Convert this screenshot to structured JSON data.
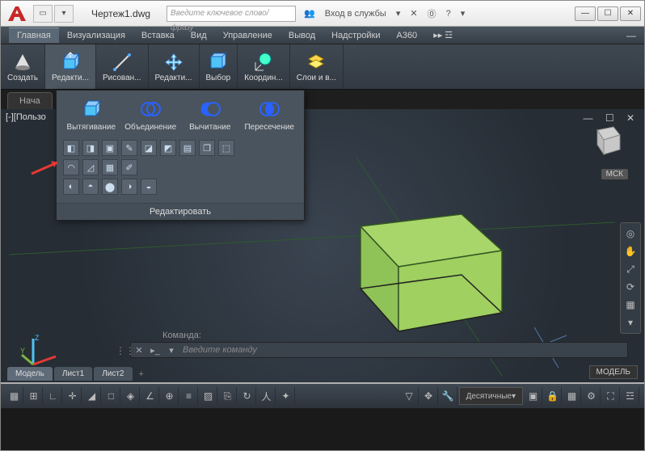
{
  "titlebar": {
    "filename": "Чертеж1.dwg",
    "search_placeholder": "Введите ключевое слово/фразу",
    "signin": "Вход в службы"
  },
  "menubar": {
    "tabs": [
      "Главная",
      "Визуализация",
      "Вставка",
      "Вид",
      "Управление",
      "Вывод",
      "Надстройки",
      "A360"
    ]
  },
  "ribbon": {
    "panels": [
      {
        "label": "Создать"
      },
      {
        "label": "Редакти..."
      },
      {
        "label": "Рисован..."
      },
      {
        "label": "Редакти..."
      },
      {
        "label": "Выбор"
      },
      {
        "label": "Координ..."
      },
      {
        "label": "Слои и в..."
      }
    ]
  },
  "file_tabs": {
    "start": "Нача",
    "items": []
  },
  "viewport": {
    "label": "[-][Пользо",
    "mcsk": "МСК"
  },
  "dropdown": {
    "commands": [
      {
        "label": "Вытягивание"
      },
      {
        "label": "Объединение"
      },
      {
        "label": "Вычитание"
      },
      {
        "label": "Пересечение"
      }
    ],
    "footer": "Редактировать"
  },
  "cmd": {
    "history": "Команда:",
    "placeholder": "Введите команду"
  },
  "layout_tabs": [
    "Модель",
    "Лист1",
    "Лист2"
  ],
  "model_badge": "МОДЕЛЬ",
  "statusbar": {
    "units": "Десятичные"
  }
}
